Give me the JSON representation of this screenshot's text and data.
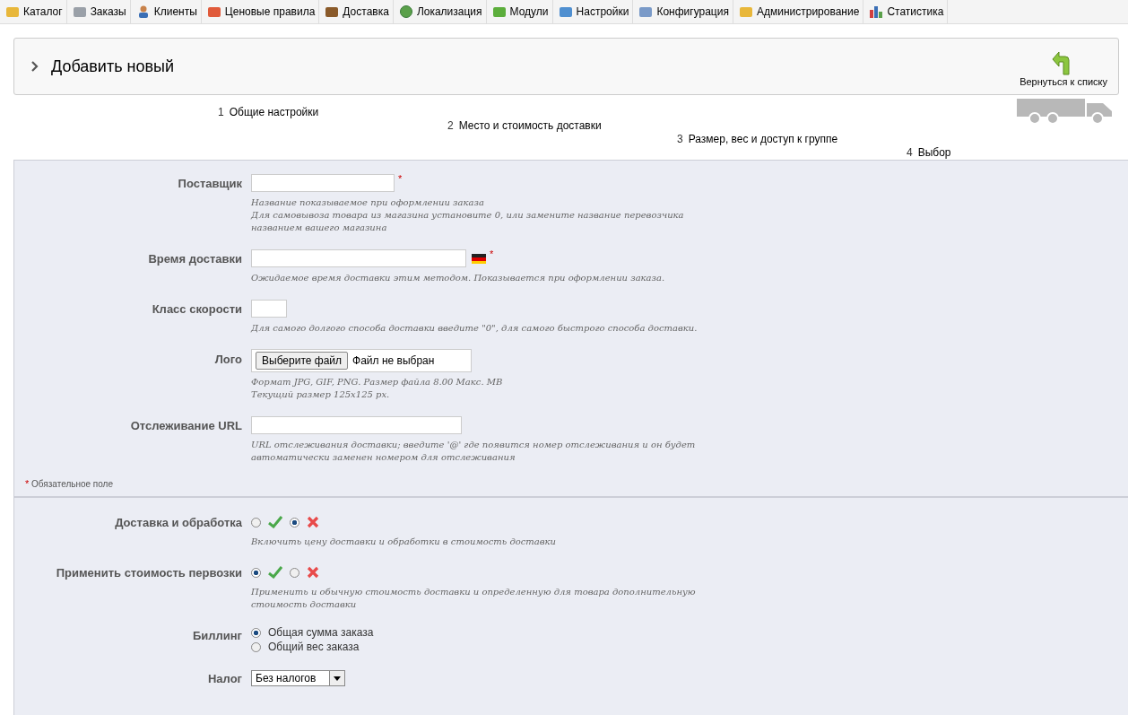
{
  "tabs": [
    {
      "label": "Каталог"
    },
    {
      "label": "Заказы"
    },
    {
      "label": "Клиенты"
    },
    {
      "label": "Ценовые правила"
    },
    {
      "label": "Доставка"
    },
    {
      "label": "Локализация"
    },
    {
      "label": "Модули"
    },
    {
      "label": "Настройки"
    },
    {
      "label": "Конфигурация"
    },
    {
      "label": "Администрирование"
    },
    {
      "label": "Статистика"
    }
  ],
  "header": {
    "title": "Добавить новый",
    "back_button": "Вернуться к списку"
  },
  "steps": [
    {
      "number": "1",
      "label": "Общие настройки"
    },
    {
      "number": "2",
      "label": "Место и стоимость доставки"
    },
    {
      "number": "3",
      "label": "Размер, вес и доступ к группе"
    },
    {
      "number": "4",
      "label": "Выбор"
    }
  ],
  "required_mark": "*",
  "sections": [
    {
      "fields": [
        {
          "kind": "text",
          "label": "Поставщик",
          "required": true,
          "localized": false,
          "hint": [
            "Название показываемое при оформлении заказа",
            "Для самовывоза товара из магазина установите 0, или замените название перевозчика названием вашего магазина"
          ]
        },
        {
          "kind": "text",
          "label": "Время доставки",
          "required": true,
          "localized": true,
          "hint": [
            "Ожидаемое время доставки этим методом. Показывается при оформлении заказа."
          ]
        },
        {
          "kind": "text",
          "label": "Класс скорости",
          "required": false,
          "localized": false,
          "hint": [
            "Для самого долгого способа доставки введите \"0\", для самого быстрого способа доставки."
          ]
        },
        {
          "kind": "file",
          "label": "Лого",
          "button": "Выберите файл",
          "status": "Файл не выбран",
          "hint": [
            "Формат JPG, GIF, PNG. Размер файла 8.00 Макс. MB",
            "Текущий размер 125x125 px."
          ]
        },
        {
          "kind": "text",
          "label": "Отслеживание URL",
          "required": false,
          "localized": false,
          "hint": [
            "URL отслеживания доставки; введите '@' где появится номер отслеживания и он будет автоматически заменен номером для отслеживания"
          ]
        }
      ],
      "required_note": "Обязательное поле"
    },
    {
      "fields": [
        {
          "kind": "yesno",
          "label": "Доставка и обработка",
          "options": [
            {
              "selected": false
            },
            {
              "selected": true
            }
          ],
          "hint": [
            "Включить цену доставки и обработки в стоимость доставки"
          ]
        },
        {
          "kind": "yesno",
          "label": "Применить стоимость первозки",
          "options": [
            {
              "selected": true
            },
            {
              "selected": false
            }
          ],
          "hint": [
            "Применить и обычную стоимость доставки и определенную для товара дополнительную стоимость доставки"
          ]
        },
        {
          "kind": "radios",
          "label": "Биллинг",
          "options": [
            {
              "label": "Общая сумма заказа",
              "selected": true
            },
            {
              "label": "Общий вес заказа",
              "selected": false
            }
          ]
        },
        {
          "kind": "select",
          "label": "Налог",
          "value": "Без налогов"
        }
      ]
    }
  ]
}
